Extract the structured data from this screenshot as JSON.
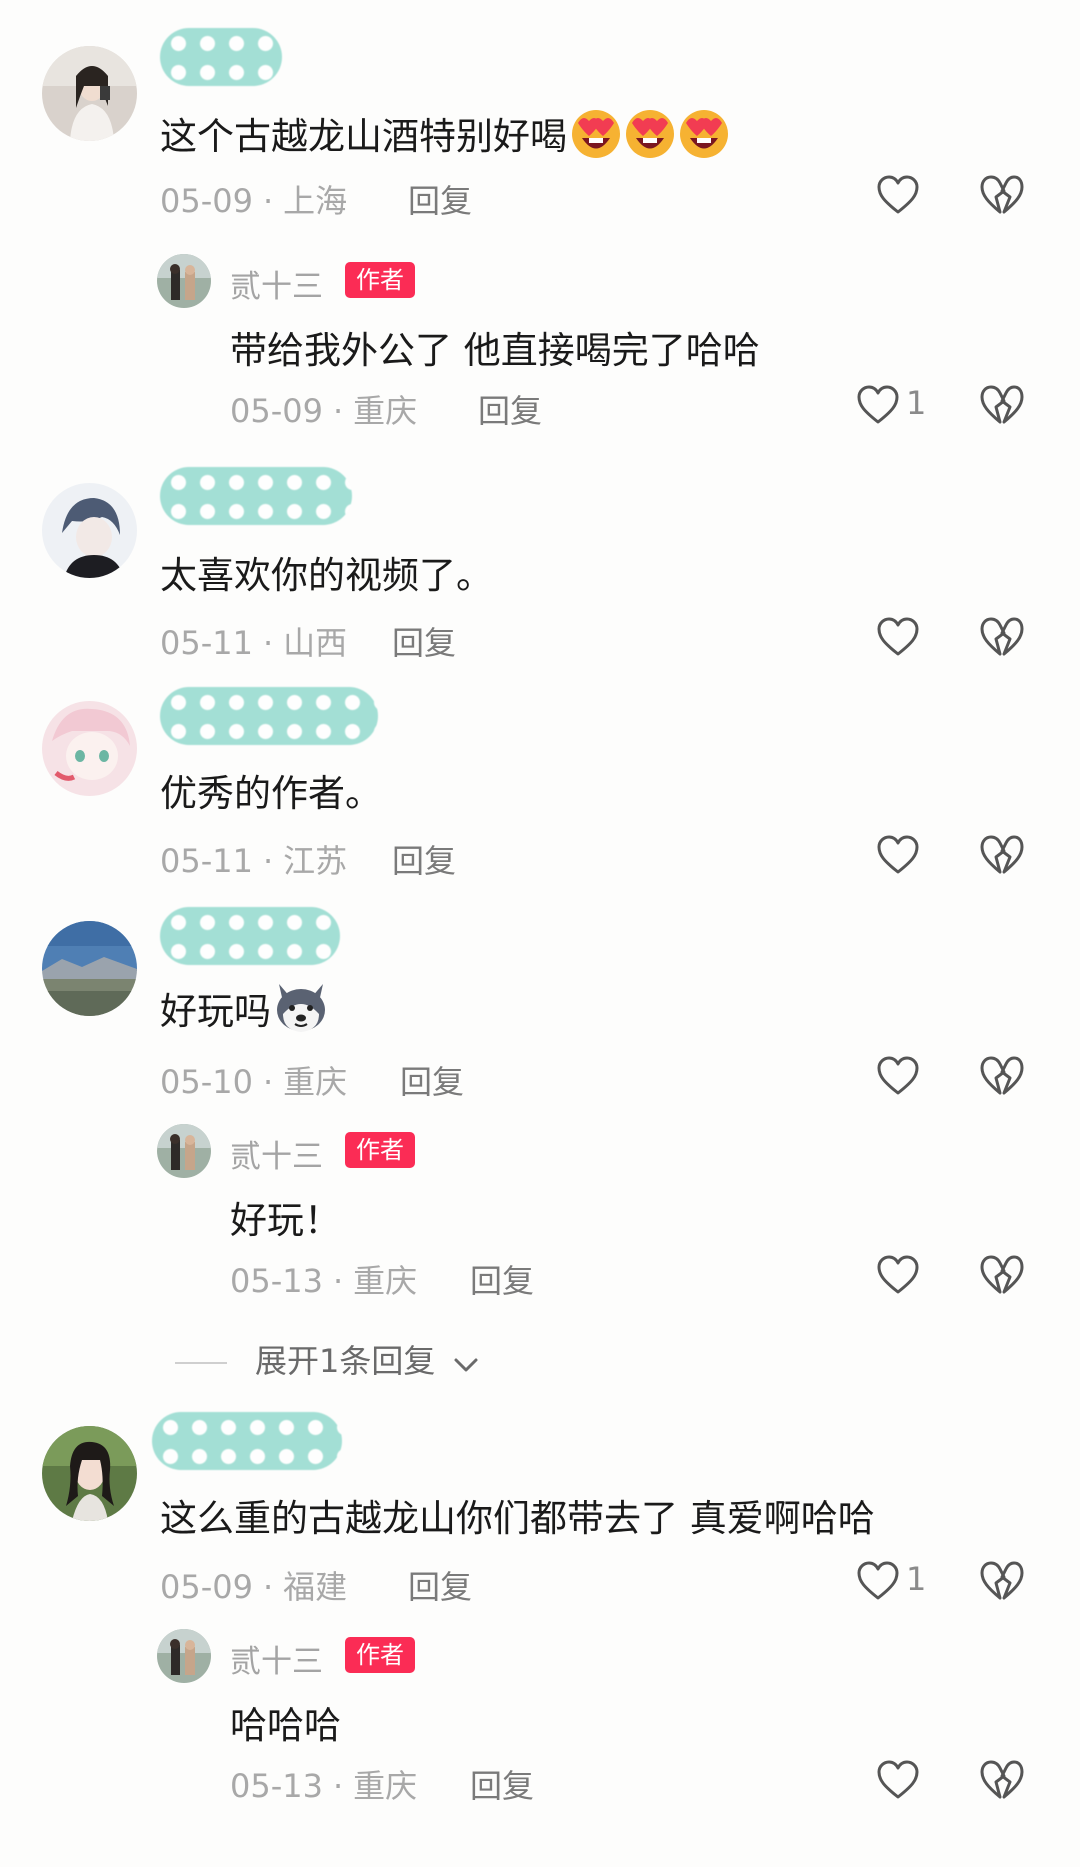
{
  "comments": [
    {
      "text": "这个古越龙山酒特别好喝",
      "date": "05-09",
      "location": "上海",
      "reply_label": "回复",
      "emoji_count": 3,
      "emoji": "heart-eyes-emoji",
      "replies": [
        {
          "author": "贰十三",
          "badge": "作者",
          "text": "带给我外公了 他直接喝完了哈哈",
          "date": "05-09",
          "location": "重庆",
          "reply_label": "回复",
          "likes": "1"
        }
      ]
    },
    {
      "text": "太喜欢你的视频了。",
      "date": "05-11",
      "location": "山西",
      "reply_label": "回复"
    },
    {
      "text": "优秀的作者。",
      "date": "05-11",
      "location": "江苏",
      "reply_label": "回复"
    },
    {
      "text": "好玩吗",
      "date": "05-10",
      "location": "重庆",
      "reply_label": "回复",
      "emoji": "husky-emoji",
      "replies": [
        {
          "author": "贰十三",
          "badge": "作者",
          "text": "好玩！",
          "date": "05-13",
          "location": "重庆",
          "reply_label": "回复"
        }
      ],
      "expand_label": "展开1条回复"
    },
    {
      "text": "这么重的古越龙山你们都带去了 真爱啊哈哈",
      "date": "05-09",
      "location": "福建",
      "reply_label": "回复",
      "likes": "1",
      "replies": [
        {
          "author": "贰十三",
          "badge": "作者",
          "text": "哈哈哈",
          "date": "05-13",
          "location": "重庆",
          "reply_label": "回复"
        }
      ]
    }
  ],
  "colors": {
    "badge": "#fb2c55",
    "username_blur": "#9fded3",
    "text": "#1a1a1a",
    "meta": "#a8a8a8"
  }
}
